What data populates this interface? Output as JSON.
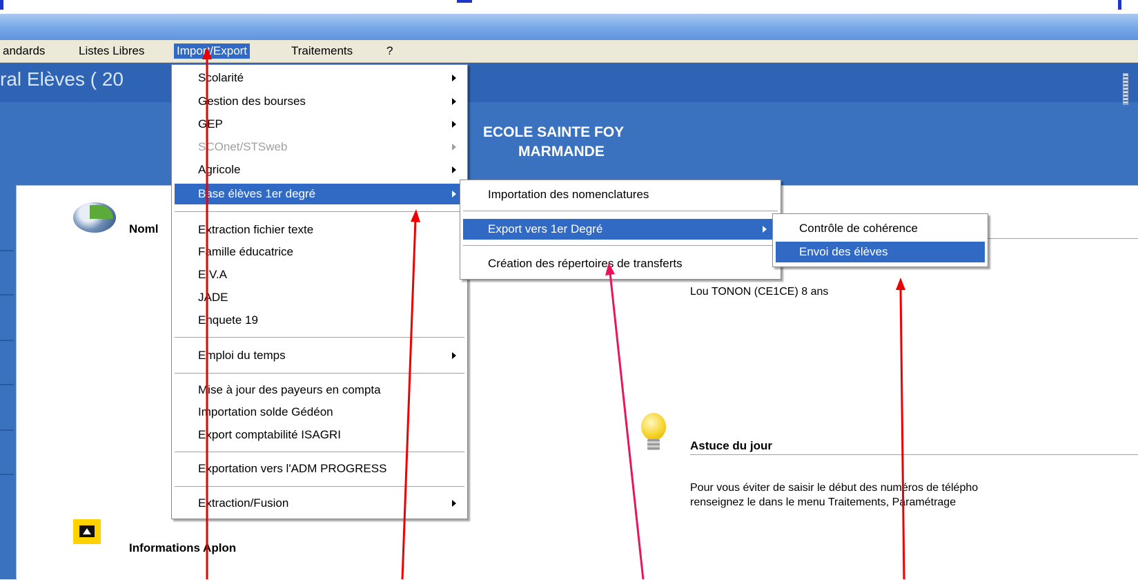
{
  "window": {
    "title_left": "ral Elèves ( 20"
  },
  "menubar": {
    "items": [
      {
        "label": "andards"
      },
      {
        "label": "Listes Libres"
      },
      {
        "label": "Import/Export"
      },
      {
        "label": "Traitements"
      },
      {
        "label": "?"
      }
    ],
    "active": "Import/Export"
  },
  "school": {
    "line1": "ECOLE SAINTE FOY",
    "line2": "MARMANDE"
  },
  "panel": {
    "nombre_heading": "Noml",
    "student_line": "Lou TONON (CE1CE) 8 ans",
    "tip_heading": "Astuce du jour",
    "tip_line1": "Pour vous éviter de saisir le début des numéros de télépho",
    "tip_line2": "renseignez le dans le menu Traitements, Paramétrage",
    "info_heading": "Informations Aplon"
  },
  "import_export_menu": {
    "items": [
      {
        "label": "Scolarité",
        "submenu": true
      },
      {
        "label": "Gestion des bourses",
        "submenu": true
      },
      {
        "label": "GEP",
        "submenu": true
      },
      {
        "label": "SCOnet/STSweb",
        "submenu": true,
        "disabled": true
      },
      {
        "label": "Agricole",
        "submenu": true
      },
      {
        "label": "Base élèves 1er degré",
        "submenu": true,
        "selected": true
      },
      {
        "label": "Extraction fichier texte"
      },
      {
        "label": "Famille éducatrice"
      },
      {
        "label": "E.V.A"
      },
      {
        "label": "JADE"
      },
      {
        "label": "Enquete 19"
      },
      {
        "label": "Emploi du temps",
        "submenu": true
      },
      {
        "label": "Mise à jour des payeurs en compta"
      },
      {
        "label": "Importation solde Gédéon"
      },
      {
        "label": "Export comptabilité ISAGRI"
      },
      {
        "label": "Exportation vers l'ADM PROGRESS"
      },
      {
        "label": "Extraction/Fusion",
        "submenu": true
      }
    ]
  },
  "base_eleves_menu": {
    "items": [
      {
        "label": "Importation des nomenclatures"
      },
      {
        "label": "Export vers 1er Degré",
        "submenu": true,
        "selected": true
      },
      {
        "label": "Création des répertoires de transferts"
      }
    ]
  },
  "export_menu": {
    "items": [
      {
        "label": "Contrôle de cohérence"
      },
      {
        "label": "Envoi des élèves",
        "selected": true
      }
    ]
  },
  "colors": {
    "menu_highlight": "#316ac5",
    "annotation_red": "#ee0000",
    "annotation_pink": "#e8155c",
    "app_blue": "#3a72c0"
  }
}
